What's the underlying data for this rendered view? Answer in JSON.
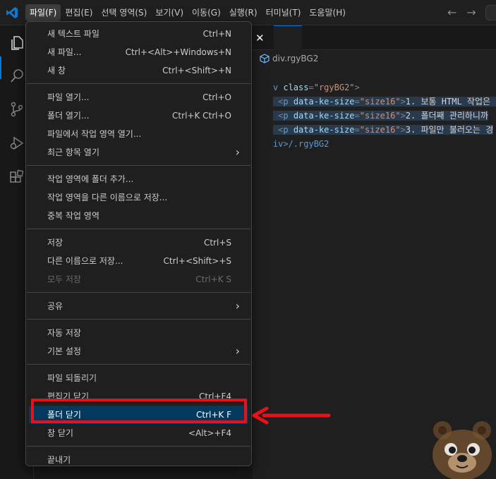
{
  "colors": {
    "accent": "#0078d4",
    "annotation": "#e8101a",
    "selected_bg": "#04395e"
  },
  "menubar": {
    "items": [
      "파일(F)",
      "편집(E)",
      "선택 영역(S)",
      "보기(V)",
      "이동(G)",
      "실행(R)",
      "터미널(T)",
      "도움말(H)"
    ],
    "active": "파일(F)"
  },
  "activity_icons": [
    "explorer-icon",
    "search-icon",
    "source-control-icon",
    "run-debug-icon",
    "extensions-icon"
  ],
  "editor": {
    "breadcrumb": "div.rgyBG2",
    "lines": [
      {
        "pre": "v ",
        "tag_open": "",
        "attr": "class",
        "val": "\"rgyBG2\"",
        "close": ">"
      },
      {
        "text": "1. 보통 HTML 작업은 c"
      },
      {
        "text": "2. 폴더째 관리하니까"
      },
      {
        "text": "3. 파일만 불러오는 경"
      },
      {
        "end": "iv>/.rgyBG2"
      }
    ],
    "p_tag": "p",
    "p_attr": "data-ke-size",
    "p_val": "\"size16\""
  },
  "file_menu": {
    "groups": [
      [
        {
          "label": "새 텍스트 파일",
          "shortcut": "Ctrl+N"
        },
        {
          "label": "새 파일...",
          "shortcut": "Ctrl+<Alt>+Windows+N"
        },
        {
          "label": "새 창",
          "shortcut": "Ctrl+<Shift>+N"
        }
      ],
      [
        {
          "label": "파일 열기...",
          "shortcut": "Ctrl+O"
        },
        {
          "label": "폴더 열기...",
          "shortcut": "Ctrl+K Ctrl+O"
        },
        {
          "label": "파일에서 작업 영역 열기...",
          "shortcut": ""
        },
        {
          "label": "최근 항목 열기",
          "shortcut": "",
          "submenu": true
        }
      ],
      [
        {
          "label": "작업 영역에 폴더 추가...",
          "shortcut": ""
        },
        {
          "label": "작업 영역을 다른 이름으로 저장...",
          "shortcut": ""
        },
        {
          "label": "중복 작업 영역",
          "shortcut": ""
        }
      ],
      [
        {
          "label": "저장",
          "shortcut": "Ctrl+S"
        },
        {
          "label": "다른 이름으로 저장...",
          "shortcut": "Ctrl+<Shift>+S"
        },
        {
          "label": "모두 저장",
          "shortcut": "Ctrl+K S",
          "disabled": true
        }
      ],
      [
        {
          "label": "공유",
          "shortcut": "",
          "submenu": true
        }
      ],
      [
        {
          "label": "자동 저장",
          "shortcut": ""
        },
        {
          "label": "기본 설정",
          "shortcut": "",
          "submenu": true
        }
      ],
      [
        {
          "label": "파일 되돌리기",
          "shortcut": ""
        },
        {
          "label": "편집기 닫기",
          "shortcut": "Ctrl+F4"
        },
        {
          "label": "폴더 닫기",
          "shortcut": "Ctrl+K F",
          "selected": true
        },
        {
          "label": "창 닫기",
          "shortcut": "<Alt>+F4"
        }
      ],
      [
        {
          "label": "끝내기",
          "shortcut": ""
        }
      ]
    ]
  }
}
